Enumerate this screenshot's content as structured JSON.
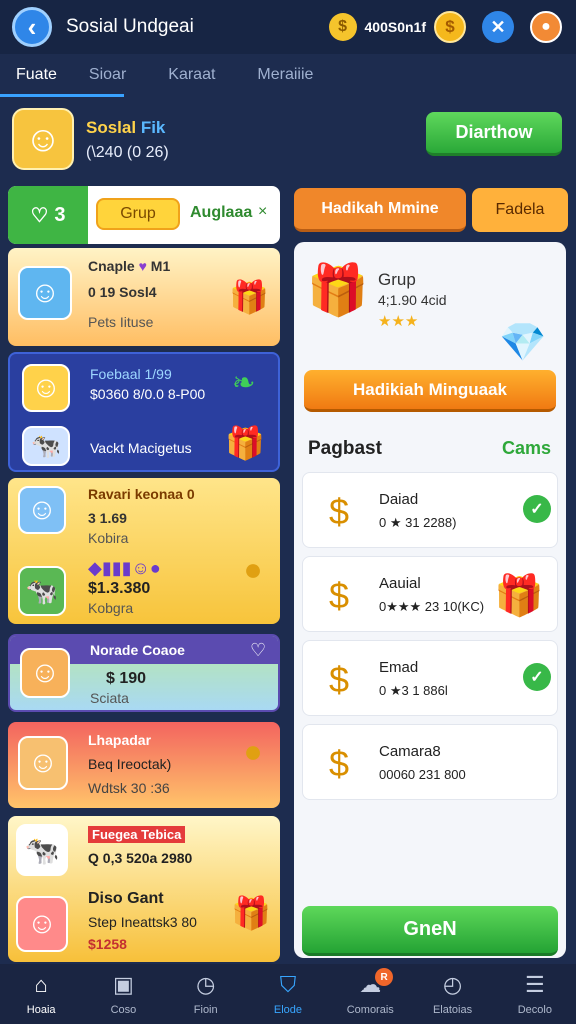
{
  "header": {
    "back_icon": "chevron-left-icon",
    "title": "Sosial Undgeai",
    "balance": "400S0n1f",
    "coin_icon": "coin-icon",
    "gold_icon": "dollar-coin-icon",
    "close_icon": "x-icon",
    "avatar_icon": "user-icon"
  },
  "tabs": [
    {
      "label": "Fuate"
    },
    {
      "label": "Sioar"
    },
    {
      "label": "Karaat"
    },
    {
      "label": "Meraiiie"
    }
  ],
  "profile": {
    "name_a": "Soslal",
    "name_b": "Fik",
    "stats": "(\\240 (0 26)",
    "button": "Diarthow"
  },
  "left": {
    "count": "3",
    "grup": "Grup",
    "label": "Auglaaa",
    "close": "×",
    "cards": [
      {
        "line1": "Cnaple",
        "line1b": "M1",
        "line2": "0 19 Sosl4",
        "line3": "Pets Iituse"
      },
      {
        "line1": "Foebaal 1/99",
        "line2": "$0360 8/0.0 8-P00",
        "line3": "Vackt Macigetus"
      },
      {
        "line1": "Ravari keonaa 0",
        "line2": "3 1.69",
        "line3": "Kobira",
        "line4": "$1.3.380",
        "line5": "Kobgra"
      },
      {
        "line1": "Norade Coaoe",
        "line2": "$ 190",
        "line3": "Sciata"
      },
      {
        "line1": "Lhapadar",
        "line2": "Beq Ireoctak)",
        "line3": "Wdtsk 30 :36"
      },
      {
        "line1": "Fuegea Tebica",
        "line2": "Q 0,3 520a 2980",
        "line3": "Diso Gant",
        "line4": "Step Ineattsk3 80",
        "line5": "$1258"
      }
    ]
  },
  "right": {
    "tab1": "Hadikah Mmine",
    "tab2": "Fadela",
    "gift_title": "Grup",
    "gift_amount": "4;1.90 4cid",
    "stars": "★★★",
    "claim": "Hadikiah Minguaak",
    "section": "Pagbast",
    "section_right": "Cams",
    "rows": [
      {
        "title": "Daiad",
        "value": "0 ★ 31 2288)",
        "checked": true
      },
      {
        "title": "Aauial",
        "value": "0★★★ 23 10(KC)",
        "checked": false
      },
      {
        "title": "Emad",
        "value": "0 ★3 1 886l",
        "checked": true
      },
      {
        "title": "Camara8",
        "value": "00060 231 800",
        "checked": false
      }
    ],
    "button": "GneN"
  },
  "nav": [
    {
      "label": "Hoaia",
      "icon": "home-icon"
    },
    {
      "label": "Coso",
      "icon": "camera-icon"
    },
    {
      "label": "Fioin",
      "icon": "clock-icon"
    },
    {
      "label": "Elode",
      "icon": "shield-icon"
    },
    {
      "label": "Comorais",
      "icon": "chat-icon",
      "badge": "R"
    },
    {
      "label": "Elatoias",
      "icon": "timer-icon"
    },
    {
      "label": "Decolo",
      "icon": "document-icon"
    }
  ],
  "colors": {
    "background": "#1d2c4f",
    "accent_blue": "#2f86e8",
    "accent_green": "#3fb544",
    "accent_orange": "#f0872a"
  }
}
